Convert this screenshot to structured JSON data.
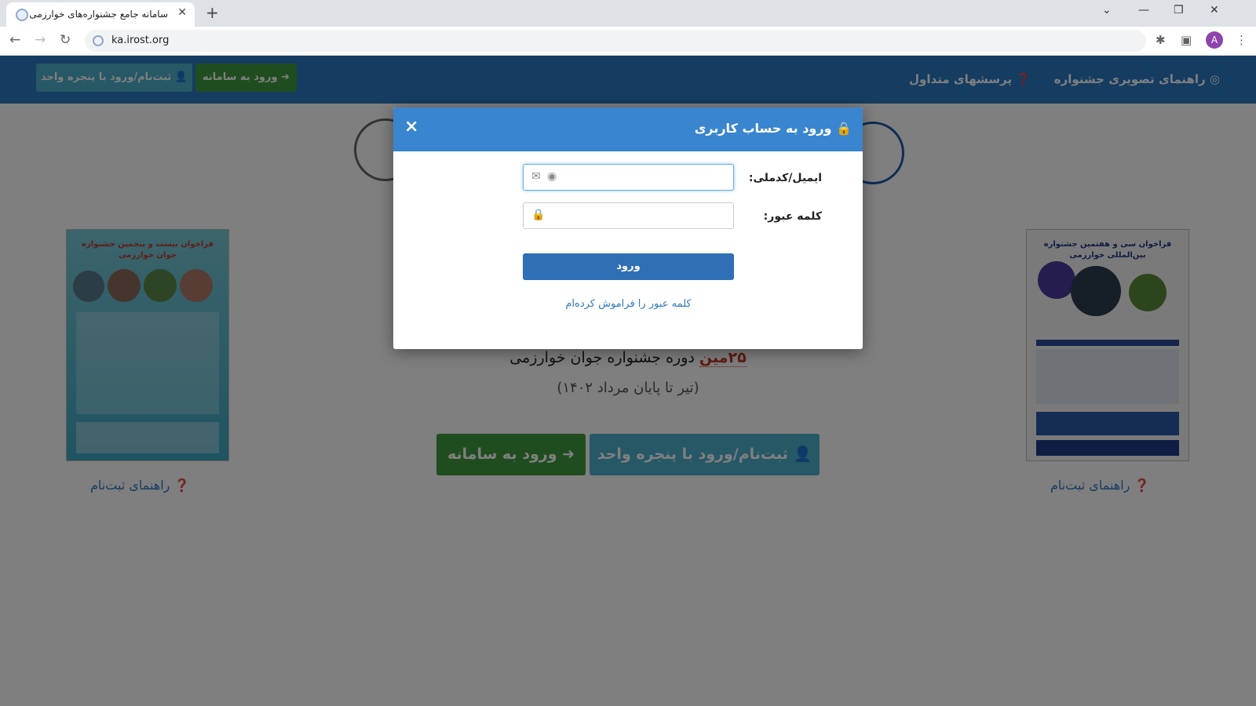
{
  "browser": {
    "tab_title": "سامانه جامع جشنواره‌های خوارزمی",
    "url": "ka.irost.org",
    "avatar_letter": "A",
    "new_tab": "+",
    "tab_close": "✕",
    "win_minimize": "—",
    "win_restore": "❐",
    "win_close": "✕",
    "tab_dropdown": "⌄",
    "back": "←",
    "forward": "→",
    "reload": "↻",
    "extensions": "✱",
    "sidepanel": "▣",
    "menu": "⋮"
  },
  "navbar": {
    "guide_link": "راهنمای تصویری جشنواره",
    "faq_link": "پرسشهای متداول",
    "login_button": "ورود به سامانه",
    "register_button": "ثبت‌نام/ورود با پنجره واحد"
  },
  "main": {
    "festival_number": "۲۵مین",
    "festival_title": " دوره جشنواره جوان خوارزمی",
    "festival_date": "(تیر تا پایان مرداد ۱۴۰۲)",
    "login_button": "ورود به سامانه",
    "register_button": "ثبت‌نام/ورود با پنجره واحد",
    "left_guide": "راهنمای ثبت‌نام",
    "right_guide": "راهنمای ثبت‌نام",
    "left_poster_title": "فراخوان بیست و پنجمین جشنواره جوان خوارزمی",
    "right_poster_title": "فراخوان سی و هفتمین جشنواره بین‌المللی خوارزمی"
  },
  "modal": {
    "title": "ورود به حساب کاربری",
    "close": "×",
    "email_label": "ایمیل/کدملی:",
    "email_value": "",
    "password_label": "کلمه عبور:",
    "password_value": "",
    "submit": "ورود",
    "forgot": "کلمه عبور را فراموش کرده‌ام"
  },
  "colors": {
    "navbar": "#2b79c2",
    "modal_header": "#3a85cf",
    "green": "#3e9a3e",
    "teal": "#4cb0cc",
    "accent_red": "#c0392b"
  }
}
